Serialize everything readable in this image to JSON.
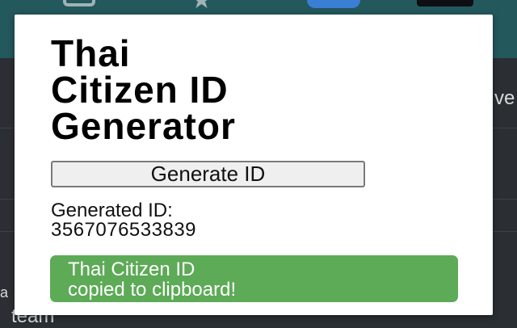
{
  "popup": {
    "title_lines": [
      "Thai",
      "Citizen ID",
      "Generator"
    ],
    "generate_button_label": "Generate ID",
    "generated_label": "Generated ID:",
    "generated_value": "3567076533839",
    "toast_lines": [
      "Thai Citizen ID",
      "copied to clipboard!"
    ]
  },
  "background": {
    "right_text": "ve",
    "bottom_text": "team",
    "mid_text": "a"
  },
  "colors": {
    "toast_bg": "#5daa57",
    "browser_bar": "#23585d",
    "extension_icon": "#3a7fd4"
  },
  "icons": [
    "tab-icon",
    "star-icon",
    "extension-icon",
    "profile-icon"
  ]
}
